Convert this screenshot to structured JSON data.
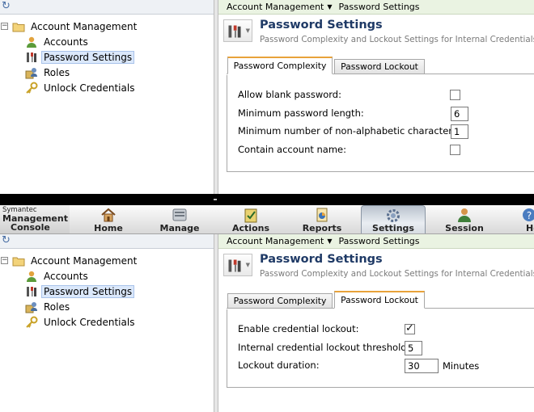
{
  "tree": {
    "items": [
      {
        "label": "Account Management",
        "icon": "folder-icon"
      },
      {
        "label": "Accounts",
        "icon": "user-icon"
      },
      {
        "label": "Password Settings",
        "icon": "tools-icon"
      },
      {
        "label": "Roles",
        "icon": "roles-icon"
      },
      {
        "label": "Unlock Credentials",
        "icon": "key-icon"
      }
    ]
  },
  "breadcrumb": {
    "root": "Account Management",
    "current": "Password Settings"
  },
  "page": {
    "title": "Password Settings",
    "subtitle": "Password Complexity and Lockout Settings for Internal Credentials"
  },
  "tabs": [
    {
      "label": "Password Complexity"
    },
    {
      "label": "Password Lockout"
    }
  ],
  "complexity": {
    "allow_blank_label": "Allow blank password:",
    "allow_blank_checked": false,
    "min_length_label": "Minimum password length:",
    "min_length_value": "6",
    "min_nonalpha_label": "Minimum number of non-alphabetic characters:",
    "min_nonalpha_value": "1",
    "contain_name_label": "Contain account name:",
    "contain_name_checked": false
  },
  "lockout": {
    "enable_label": "Enable credential lockout:",
    "enable_checked": true,
    "threshold_label": "Internal credential lockout threshold:",
    "threshold_value": "5",
    "duration_label": "Lockout duration:",
    "duration_value": "30",
    "duration_unit": "Minutes"
  },
  "toolbar": {
    "brand_small": "Symantec",
    "brand_line1": "Management",
    "brand_line2": "Console",
    "buttons": [
      {
        "label": "Home"
      },
      {
        "label": "Manage"
      },
      {
        "label": "Actions"
      },
      {
        "label": "Reports"
      },
      {
        "label": "Settings"
      },
      {
        "label": "Session"
      },
      {
        "label": "He"
      }
    ]
  },
  "colors": {
    "title_blue": "#1f3a66",
    "tab_accent": "#e8a23a",
    "breadcrumb_bg": "#eaf3e2",
    "selection_bg": "#dbe8fb"
  }
}
